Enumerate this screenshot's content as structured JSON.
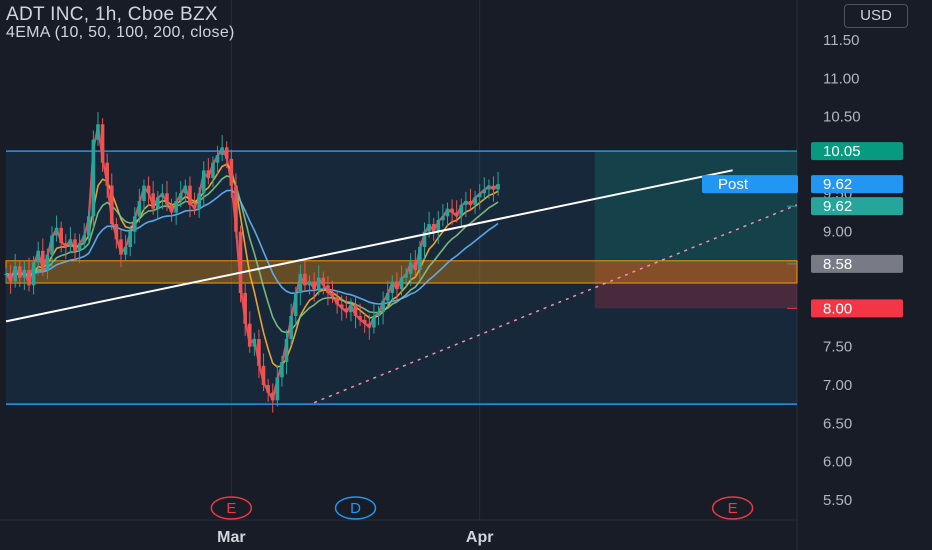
{
  "header": {
    "symbol": "ADT INC, 1h, Cboe BZX",
    "indicator": "4EMA (10, 50, 100, 200, close)",
    "currency": "USD"
  },
  "chart_data": {
    "type": "candlestick",
    "ylim": [
      5.2,
      12.0
    ],
    "y_ticks": [
      11.5,
      11.0,
      10.5,
      9.5,
      9.0,
      7.5,
      7.0,
      6.5,
      6.0,
      5.5
    ],
    "y_tick_labels": [
      "11.50",
      "11.00",
      "10.50",
      "9.50",
      "9.00",
      "7.50",
      "7.00",
      "6.50",
      "6.00",
      "5.50"
    ],
    "x_ticks": [
      {
        "label": "Mar",
        "x": 49
      },
      {
        "label": "Apr",
        "x": 103
      }
    ],
    "x_range": [
      0,
      172
    ],
    "price_tags": [
      {
        "value": 10.05,
        "label": "10.05",
        "color": "#089981"
      },
      {
        "value": 9.62,
        "label": "9.62",
        "color": "#2196f3",
        "badge": "Post"
      },
      {
        "value": 9.62,
        "label": "9.62",
        "color": "#26a69a",
        "offset": 1
      },
      {
        "value": 8.58,
        "label": "8.58",
        "color": "#787b86"
      },
      {
        "value": 8.0,
        "label": "8.00",
        "color": "#f23645"
      }
    ],
    "events": [
      {
        "label": "E",
        "x": 49,
        "color": "#f23645"
      },
      {
        "label": "D",
        "x": 76,
        "color": "#2196f3"
      },
      {
        "label": "E",
        "x": 158,
        "color": "#f23645"
      }
    ],
    "channel": {
      "top": 10.05,
      "bottom": 6.75,
      "x_start": 0,
      "x_end": 172
    },
    "zone": {
      "top": 8.62,
      "bottom": 8.33,
      "x_start": 0,
      "x_end": 172
    },
    "position": {
      "x_start": 128,
      "x_end": 172,
      "entry": 8.58,
      "target": 10.05,
      "stop": 8.0
    },
    "trend_line": {
      "x1": 0,
      "y1": 7.83,
      "x2": 158,
      "y2": 9.8
    },
    "support_line": {
      "x1": 67,
      "y1": 6.77,
      "x2": 172,
      "y2": 9.35
    },
    "closes": [
      8.45,
      8.35,
      8.55,
      8.4,
      8.5,
      8.3,
      8.6,
      8.75,
      8.5,
      8.7,
      8.95,
      9.05,
      8.85,
      8.8,
      8.9,
      8.75,
      8.85,
      8.95,
      9.2,
      10.2,
      10.4,
      9.9,
      9.6,
      9.1,
      8.9,
      8.7,
      8.8,
      9.0,
      9.2,
      9.4,
      9.6,
      9.5,
      9.3,
      9.45,
      9.5,
      9.35,
      9.25,
      9.4,
      9.5,
      9.6,
      9.35,
      9.3,
      9.5,
      9.8,
      9.7,
      9.9,
      10.0,
      10.1,
      9.95,
      9.6,
      9.0,
      8.2,
      7.8,
      7.5,
      7.6,
      7.25,
      7.0,
      6.9,
      6.8,
      7.1,
      7.3,
      7.6,
      7.9,
      8.2,
      8.45,
      8.3,
      8.35,
      8.25,
      8.4,
      8.3,
      8.2,
      8.15,
      8.05,
      8.0,
      7.95,
      8.05,
      7.9,
      7.85,
      7.8,
      7.75,
      7.9,
      7.95,
      8.1,
      8.2,
      8.35,
      8.25,
      8.4,
      8.45,
      8.6,
      8.5,
      8.8,
      9.0,
      9.1,
      9.0,
      9.15,
      9.2,
      9.3,
      9.25,
      9.2,
      9.35,
      9.4,
      9.35,
      9.45,
      9.5,
      9.55,
      9.6,
      9.55,
      9.62
    ],
    "ema_series": [
      {
        "period": 10,
        "color": "#f7525f"
      },
      {
        "period": 50,
        "color": "#ffb02e"
      },
      {
        "period": 100,
        "color": "#81c784"
      },
      {
        "period": 200,
        "color": "#64b5f6"
      }
    ]
  }
}
